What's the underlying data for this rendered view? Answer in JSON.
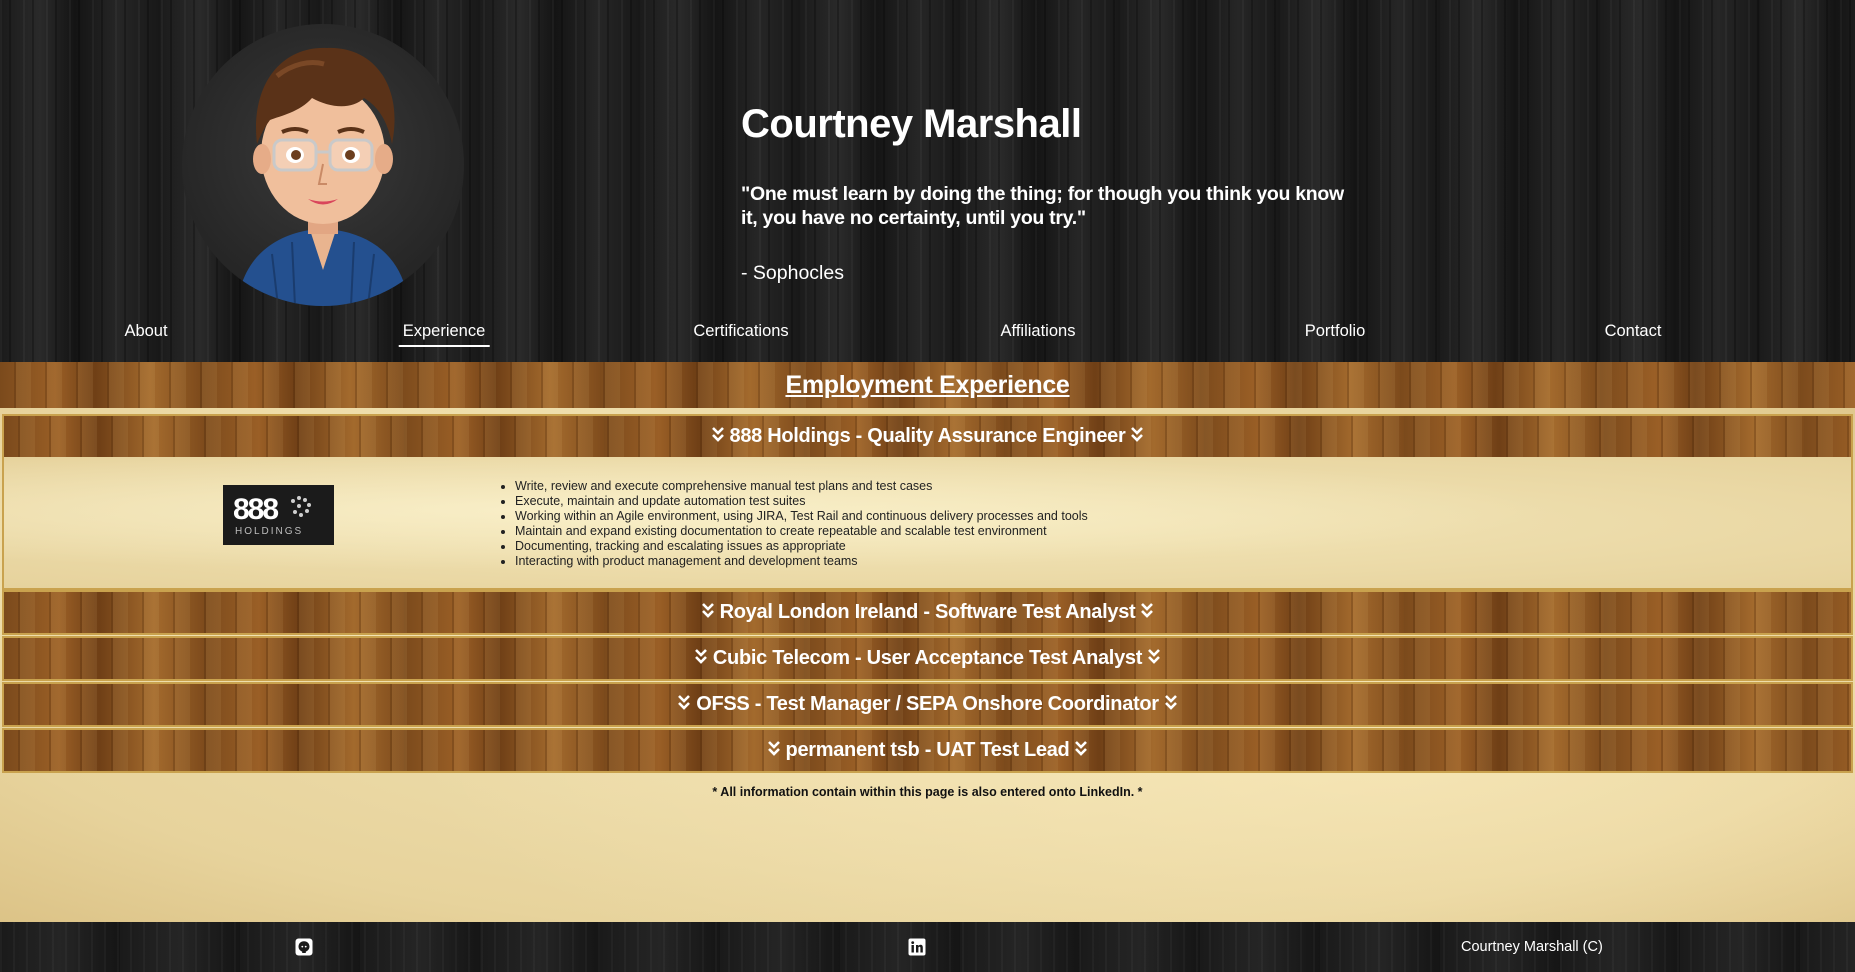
{
  "header": {
    "name": "Courtney Marshall",
    "quote": "\"One must learn by doing the thing; for though you think you know it, you have no certainty, until you try.\"",
    "quote_author": "- Sophocles",
    "avatar_icon": "cartoon-avatar"
  },
  "nav": {
    "items": [
      {
        "label": "About"
      },
      {
        "label": "Experience",
        "active": true
      },
      {
        "label": "Certifications"
      },
      {
        "label": "Affiliations"
      },
      {
        "label": "Portfolio"
      },
      {
        "label": "Contact"
      }
    ]
  },
  "main": {
    "title": "Employment Experience",
    "jobs": [
      {
        "label": "888 Holdings - Quality Assurance Engineer",
        "expanded": true,
        "logo_text": "888",
        "logo_subtext": "HOLDINGS",
        "duties": [
          "Write, review and execute comprehensive manual test plans and test cases",
          "Execute, maintain and update automation test suites",
          "Working within an Agile environment, using JIRA, Test Rail and continuous delivery processes and tools",
          "Maintain and expand existing documentation to create repeatable and scalable test environment",
          "Documenting, tracking and escalating issues as appropriate",
          "Interacting with product management and development teams"
        ]
      },
      {
        "label": "Royal London Ireland - Software Test Analyst",
        "expanded": false
      },
      {
        "label": "Cubic Telecom - User Acceptance Test Analyst",
        "expanded": false
      },
      {
        "label": "OFSS - Test Manager / SEPA Onshore Coordinator",
        "expanded": false
      },
      {
        "label": "permanent tsb - UAT Test Lead",
        "expanded": false
      }
    ],
    "note": "* All information contain within this page is also entered onto LinkedIn. *"
  },
  "footer": {
    "github_icon": "github-icon",
    "linkedin_icon": "linkedin-icon",
    "copyright": "Courtney Marshall (C)"
  },
  "colors": {
    "wood_dark": "#1c1c1c",
    "wood_brown": "#8a5522",
    "parchment": "#eedfae",
    "border_gold": "#c9a24e"
  }
}
